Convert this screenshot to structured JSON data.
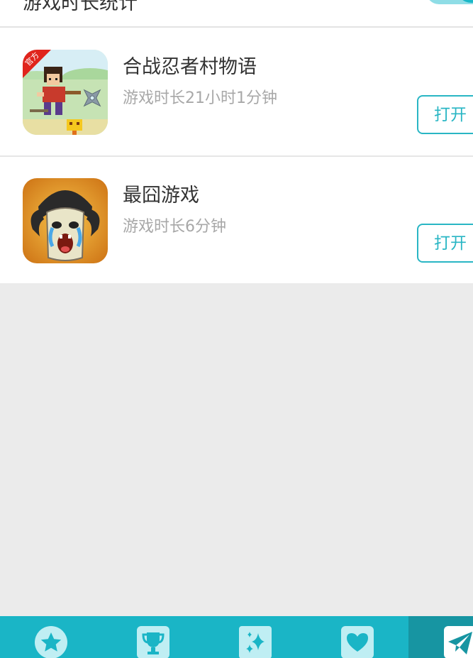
{
  "header": {
    "title": "游戏时长统计",
    "toggle_on": true
  },
  "games": [
    {
      "name": "合战忍者村物语",
      "playtime": "游戏时长21小时1分钟",
      "badge": "官方",
      "open_label": "打开",
      "icon": "ninja-village-game-icon"
    },
    {
      "name": "最囧游戏",
      "playtime": "游戏时长6分钟",
      "open_label": "打开",
      "icon": "crying-face-game-icon"
    }
  ],
  "tabs": [
    {
      "icon": "star-icon"
    },
    {
      "icon": "trophy-icon"
    },
    {
      "icon": "sparkle-icon"
    },
    {
      "icon": "heart-icon"
    },
    {
      "icon": "send-icon",
      "active": true
    }
  ],
  "colors": {
    "accent": "#1ab5c6",
    "tab_active": "#1795a2",
    "button_border": "#29b6c4",
    "background": "#ebebeb"
  }
}
